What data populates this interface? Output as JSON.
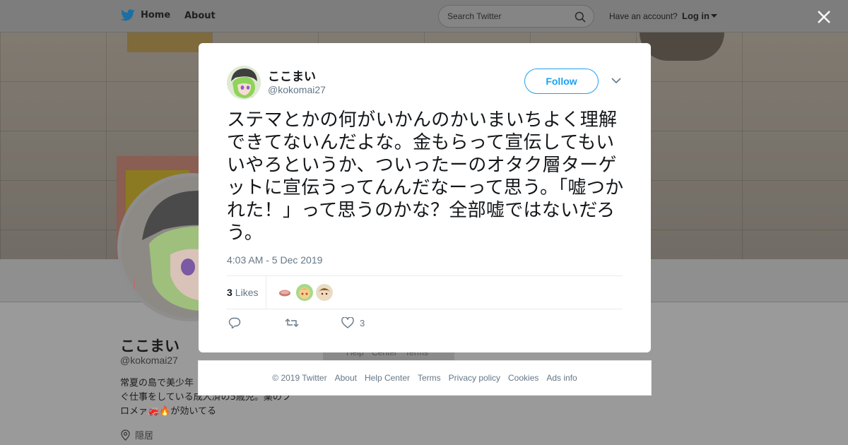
{
  "nav": {
    "home_label": "Home",
    "about_label": "About",
    "search_placeholder": "Search Twitter",
    "have_account": "Have an account?",
    "login_label": "Log in"
  },
  "profile": {
    "name": "ここまい",
    "handle": "@kokomai27",
    "bio_line1": "常夏の島で美少年",
    "bio_line2": "ぐ仕事をしている成人済の5歳児。薬のフ",
    "bio_line3": "ロメァ🚒🔥が効いてる",
    "location": "隠居",
    "bg_help": "Help Center Terms"
  },
  "tweet": {
    "author_name": "ここまい",
    "author_handle": "@kokomai27",
    "follow_label": "Follow",
    "text": "ステマとかの何がいかんのかいまいちよく理解できてないんだよな。金もらって宣伝してもいいやろというか、ついったーのオタク層ターゲットに宣伝うってんんだなーって思う。「嘘つかれた！」って思うのかな？全部嘘ではないだろう。",
    "timestamp": "4:03 AM - 5 Dec 2019",
    "likes_count": "3",
    "likes_label": "Likes",
    "like_action_count": "3"
  },
  "footer": {
    "copyright": "© 2019 Twitter",
    "about": "About",
    "help": "Help Center",
    "terms": "Terms",
    "privacy": "Privacy policy",
    "cookies": "Cookies",
    "ads": "Ads info"
  },
  "colors": {
    "accent": "#1da1f2",
    "text_primary": "#14171a",
    "text_secondary": "#657786",
    "overlay": "#9a9a9a"
  },
  "icons": [
    "twitter-bird-icon",
    "search-icon",
    "caret-down-icon",
    "close-icon",
    "reply-icon",
    "retweet-icon",
    "heart-icon",
    "location-pin-icon"
  ]
}
